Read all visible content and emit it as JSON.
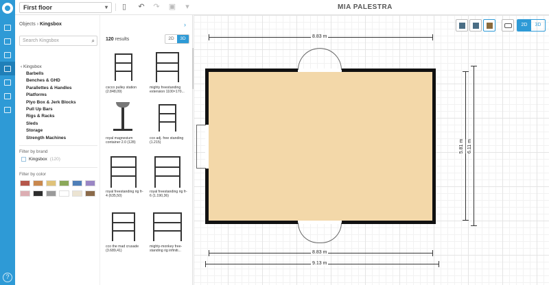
{
  "topbar": {
    "floor_select": "First floor",
    "project_title": "MIA PALESTRA"
  },
  "catalog": {
    "breadcrumb_root": "Objects",
    "breadcrumb_current": "Kingsbox",
    "search_placeholder": "Search Kingsbox",
    "category_root": "Kingsbox",
    "categories": [
      "Barbells",
      "Benches & GHD",
      "Parallettes & Handles",
      "Platforms",
      "Plyo Box & Jerk Blocks",
      "Pull Up Bars",
      "Rigs & Racks",
      "Sleds",
      "Storage",
      "Strength Machines"
    ],
    "filter_brand_title": "Filter by brand",
    "brand_name": "Kingsbox",
    "brand_count": "(120)",
    "filter_color_title": "Filter by color",
    "colors": [
      "#b5574a",
      "#c9884e",
      "#dfc27a",
      "#8ba85a",
      "#4f7fb8",
      "#9a86c4",
      "#dcaeb3",
      "#2d2d2d",
      "#9a9a9a",
      "#ffffff",
      "#ece4d2",
      "#8b6a4a"
    ],
    "results_count": "120",
    "results_label": "results",
    "toggle_2d": "2D",
    "toggle_3d": "3D",
    "items": [
      {
        "name": "cscco pulley station (2.848,09)"
      },
      {
        "name": "mighty freestanding extension 1100×170..."
      },
      {
        "name": "royal magnesium container 2.0 (128)"
      },
      {
        "name": "cco adj. free standing (1.215)"
      },
      {
        "name": "royal freestanding rig fr-4 (635,50)"
      },
      {
        "name": "royal freestanding rig fr-6 (1.190,36)"
      },
      {
        "name": "cco the mad crusade (3.689,41)"
      },
      {
        "name": "mighty-monkey free-standing rig infiniti..."
      }
    ]
  },
  "canvas": {
    "mode_2d": "2D",
    "mode_3d": "3D",
    "dim_top": "8.83 m",
    "dim_bottom_inner": "8.83 m",
    "dim_bottom_outer": "9.13 m",
    "dim_right_inner": "5.81 m",
    "dim_right_outer": "6.11 m",
    "floor_color": "#f3d8a9"
  }
}
